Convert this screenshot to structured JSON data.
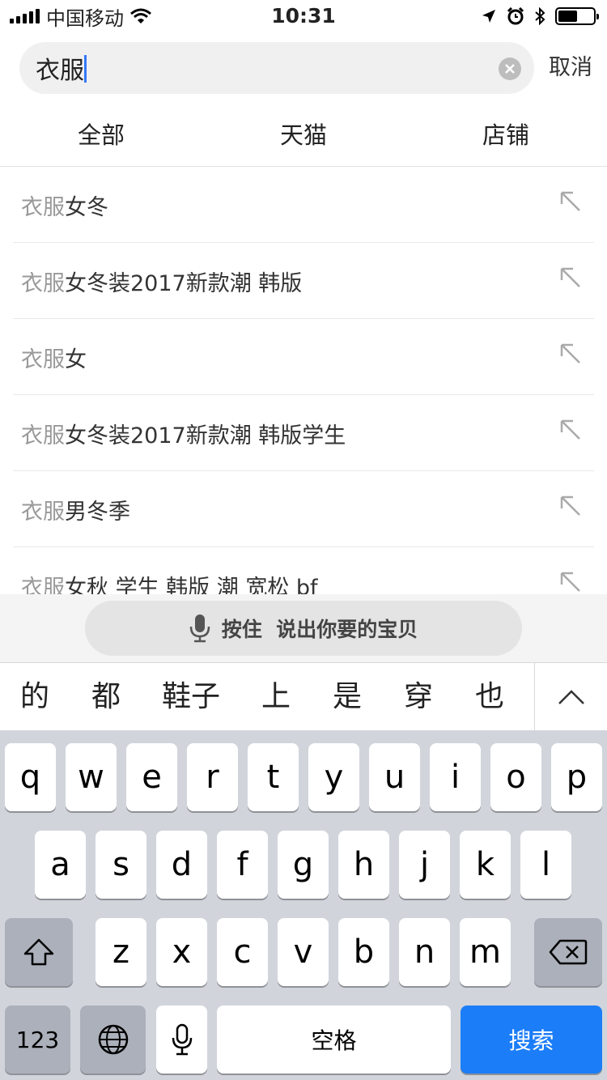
{
  "status_bar": {
    "carrier": "中国移动",
    "time": "10:31",
    "battery_level": 0.55
  },
  "search": {
    "value": "衣服",
    "cancel_label": "取消"
  },
  "tabs": [
    {
      "label": "全部",
      "active": true
    },
    {
      "label": "天猫",
      "active": false
    },
    {
      "label": "店铺",
      "active": false
    }
  ],
  "suggestions": [
    {
      "prefix": "衣服",
      "rest": "女冬"
    },
    {
      "prefix": "衣服",
      "rest": "女冬装2017新款潮 韩版"
    },
    {
      "prefix": "衣服",
      "rest": "女"
    },
    {
      "prefix": "衣服",
      "rest": "女冬装2017新款潮 韩版学生"
    },
    {
      "prefix": "衣服",
      "rest": "男冬季"
    },
    {
      "prefix": "衣服",
      "rest": "女秋 学生 韩版 潮 宽松 bf"
    }
  ],
  "voice": {
    "label": "按住  说出你要的宝贝"
  },
  "candidates": [
    "的",
    "都",
    "鞋子",
    "上",
    "是",
    "穿",
    "也"
  ],
  "keyboard": {
    "row1": [
      "q",
      "w",
      "e",
      "r",
      "t",
      "y",
      "u",
      "i",
      "o",
      "p"
    ],
    "row2": [
      "a",
      "s",
      "d",
      "f",
      "g",
      "h",
      "j",
      "k",
      "l"
    ],
    "row3": [
      "z",
      "x",
      "c",
      "v",
      "b",
      "n",
      "m"
    ],
    "numbers_label": "123",
    "space_label": "空格",
    "search_label": "搜索"
  },
  "colors": {
    "accent": "#ff5000",
    "keyboard_search": "#1b7df7"
  },
  "icons": {
    "wifi": "wifi-icon",
    "location": "location-arrow-icon",
    "alarm": "alarm-icon",
    "bluetooth": "bluetooth-icon",
    "clear": "clear-icon",
    "suggest_arrow": "arrow-up-left-icon",
    "voice_mic": "microphone-icon",
    "collapse": "chevron-up-icon",
    "shift": "shift-icon",
    "delete": "backspace-icon",
    "globe": "globe-icon",
    "dictation": "microphone-icon"
  }
}
